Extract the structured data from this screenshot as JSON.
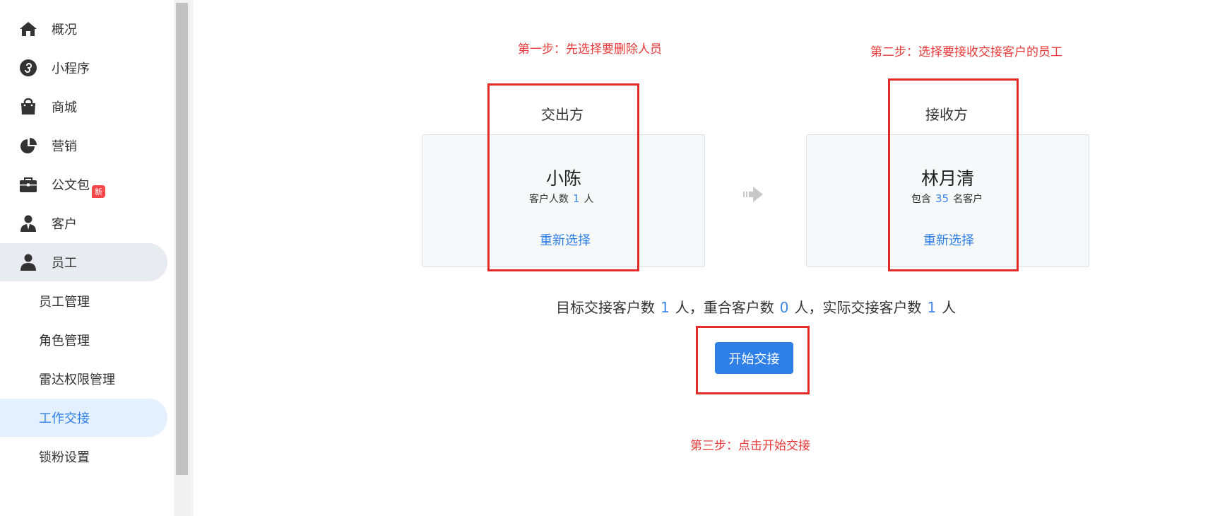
{
  "sidebar": {
    "items": [
      {
        "label": "概况",
        "icon": "home-icon"
      },
      {
        "label": "小程序",
        "icon": "mini-program-icon"
      },
      {
        "label": "商城",
        "icon": "shopping-bag-icon"
      },
      {
        "label": "营销",
        "icon": "pie-chart-icon"
      },
      {
        "label": "公文包",
        "icon": "briefcase-icon",
        "badge": "新"
      },
      {
        "label": "客户",
        "icon": "customer-icon"
      },
      {
        "label": "员工",
        "icon": "user-icon"
      }
    ],
    "sub_items": [
      {
        "label": "员工管理"
      },
      {
        "label": "角色管理"
      },
      {
        "label": "雷达权限管理"
      },
      {
        "label": "工作交接"
      },
      {
        "label": "锁粉设置"
      }
    ]
  },
  "annotations": {
    "step1": "第一步：先选择要删除人员",
    "step2": "第二步：选择要接收交接客户的员工",
    "step3": "第三步：点击开始交接"
  },
  "handover": {
    "from": {
      "title": "交出方",
      "name": "小陈",
      "count_prefix": "客户人数",
      "count": "1",
      "count_suffix": "人",
      "reselect": "重新选择"
    },
    "to": {
      "title": "接收方",
      "name": "林月清",
      "count_prefix": "包含",
      "count": "35",
      "count_suffix": "名客户",
      "reselect": "重新选择"
    }
  },
  "summary": {
    "target_label": "目标交接客户数",
    "target_count": "1",
    "overlap_label": "人，重合客户数",
    "overlap_count": "0",
    "actual_label": "人，实际交接客户数",
    "actual_count": "1",
    "unit": "人"
  },
  "start_button": "开始交接",
  "colors": {
    "accent": "#2f7fe8",
    "annotation_red": "#e8393a",
    "badge_red": "#f5484b"
  }
}
